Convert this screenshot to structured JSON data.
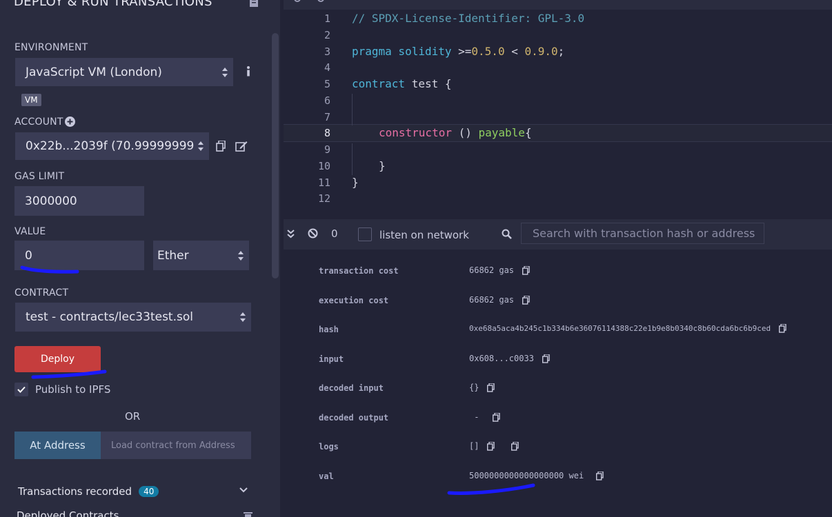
{
  "left": {
    "title": "DEPLOY & RUN TRANSACTIONS",
    "environment_label": "ENVIRONMENT",
    "environment_value": "JavaScript VM (London)",
    "vm_badge": "VM",
    "account_label": "ACCOUNT",
    "account_value": "0x22b...2039f (70.99999999",
    "gas_label": "GAS LIMIT",
    "gas_value": "3000000",
    "value_label": "VALUE",
    "value_value": "0",
    "unit_value": "Ether",
    "contract_label": "CONTRACT",
    "contract_value": "test - contracts/lec33test.sol",
    "deploy_label": "Deploy",
    "publish_label": "Publish to IPFS",
    "or_label": "OR",
    "at_address_label": "At Address",
    "load_placeholder": "Load contract from Address",
    "transactions_label": "Transactions recorded",
    "transactions_count": "40",
    "deployed_label": "Deployed Contracts"
  },
  "editor": {
    "lines": [
      "1",
      "2",
      "3",
      "4",
      "5",
      "6",
      "7",
      "8",
      "9",
      "10",
      "11",
      "12"
    ],
    "code": {
      "l1": "// SPDX-License-Identifier: GPL-3.0",
      "l3_kw": "pragma solidity",
      "l3_op": " >=",
      "l3_v1": "0.5.0",
      "l3_mid": " < ",
      "l3_v2": "0.9.0",
      "l3_end": ";",
      "l5_kw": "contract",
      "l5_rest": " test {",
      "l8_fn": "constructor",
      "l8_mid": " () ",
      "l8_pay": "payable",
      "l8_end": "{",
      "l10": "}",
      "l11": "}"
    }
  },
  "terminal": {
    "pending_count": "0",
    "listen_label": "listen on network",
    "search_placeholder": "Search with transaction hash or address",
    "rows": [
      {
        "key": "transaction cost",
        "value": "66862 gas"
      },
      {
        "key": "execution cost",
        "value": "66862 gas"
      },
      {
        "key": "hash",
        "value": "0xe68a5aca4b245c1b334b6e36076114388c22e1b9e8b0340c8b60cda6bc6b9ced"
      },
      {
        "key": "input",
        "value": "0x608...c0033"
      },
      {
        "key": "decoded input",
        "value": "{}"
      },
      {
        "key": "decoded output",
        "value": " - "
      },
      {
        "key": "logs",
        "value": "[]"
      },
      {
        "key": "val",
        "value": "5000000000000000000 wei"
      }
    ]
  },
  "colors": {
    "panel_bg": "#2a2c3f",
    "editor_bg": "#222336",
    "deploy_red": "#c53d3d",
    "annotation_blue": "#1a1aff"
  }
}
